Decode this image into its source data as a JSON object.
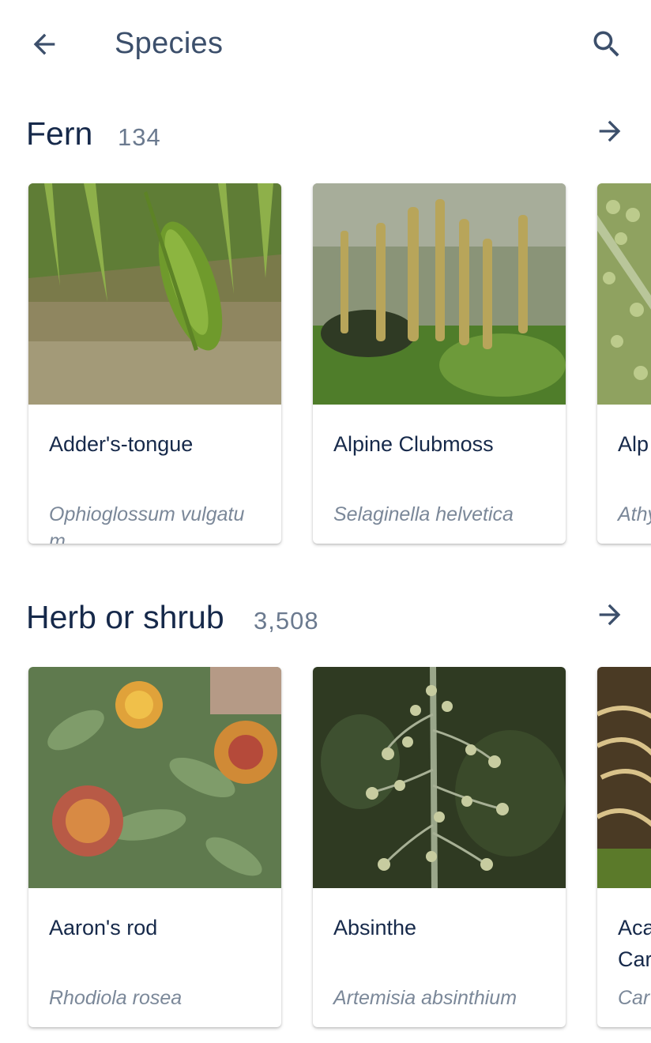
{
  "appbar": {
    "title": "Species"
  },
  "sections": [
    {
      "title": "Fern",
      "count": "134",
      "cards": [
        {
          "name": "Adder's-tongue",
          "scientific": "Ophioglossum vulgatum"
        },
        {
          "name": "Alpine Clubmoss",
          "scientific": "Selaginella helvetica"
        },
        {
          "name": "Alp",
          "scientific": "Athy m"
        }
      ]
    },
    {
      "title": "Herb or shrub",
      "count": "3,508",
      "cards": [
        {
          "name": "Aaron's rod",
          "scientific": "Rhodiola rosea"
        },
        {
          "name": "Absinthe",
          "scientific": "Artemisia absinthium"
        },
        {
          "name": "Aca Car",
          "scientific": "Car"
        }
      ]
    }
  ],
  "icons": {
    "back": "arrow-back-icon",
    "search": "search-icon",
    "section_more": "arrow-forward-icon"
  },
  "colors": {
    "title": "#16294a",
    "count": "#6b7a8f",
    "scientific": "#7b8899",
    "icon": "#3c4f6b"
  }
}
